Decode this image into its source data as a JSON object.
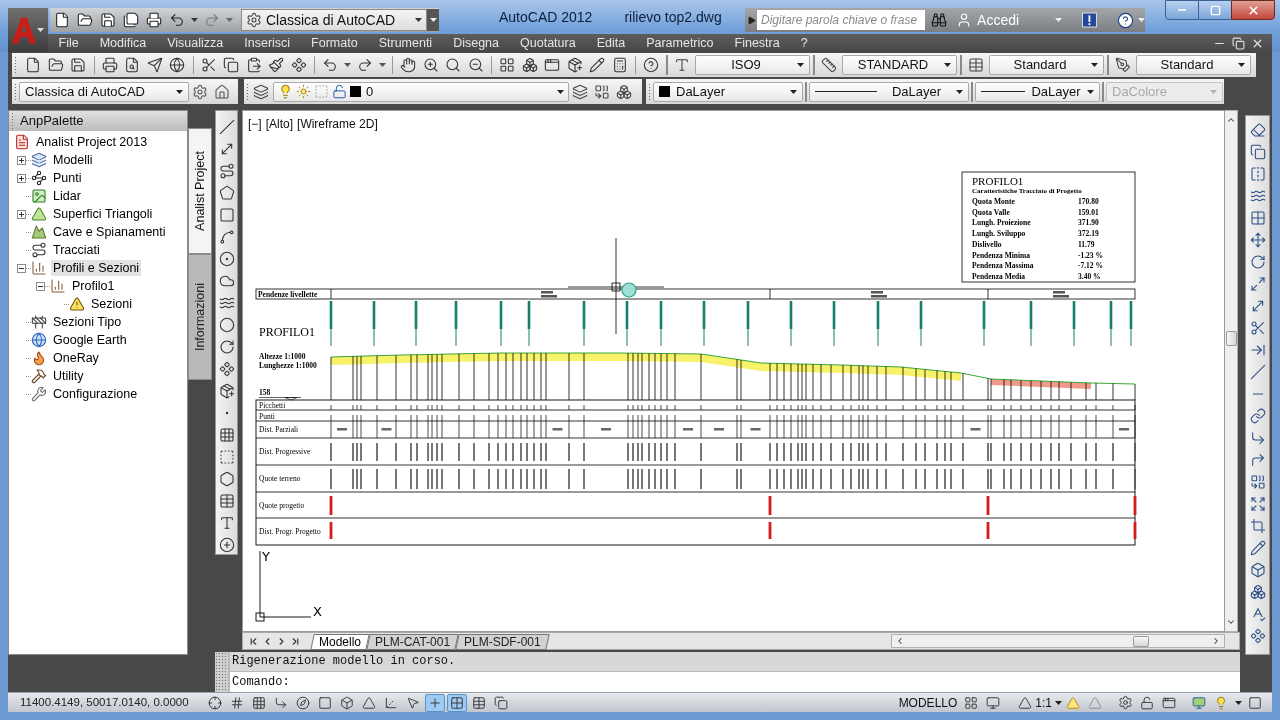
{
  "title": {
    "app": "AutoCAD 2012",
    "file": "rilievo top2.dwg"
  },
  "quick_access": {
    "workspace": "Classica di AutoCAD"
  },
  "infocenter": {
    "placeholder": "Digitare parola chiave o frase",
    "sign_in": "Accedi"
  },
  "menu": [
    "File",
    "Modifica",
    "Visualizza",
    "Inserisci",
    "Formato",
    "Strumenti",
    "Disegna",
    "Quotatura",
    "Edita",
    "Parametrico",
    "Finestra",
    "?"
  ],
  "style_toolbar": [
    {
      "kind": "text",
      "value": "ISO9"
    },
    {
      "kind": "dimension",
      "value": "STANDARD"
    },
    {
      "kind": "table",
      "value": "Standard"
    },
    {
      "kind": "multileader",
      "value": "Standard"
    }
  ],
  "workspace_toolbar": {
    "workspace": "Classica di AutoCAD"
  },
  "layer_toolbar": {
    "layer": "0"
  },
  "properties_toolbar": [
    {
      "kind": "color",
      "value": "DaLayer",
      "disabled": false
    },
    {
      "kind": "linetype",
      "value": "DaLayer",
      "disabled": false
    },
    {
      "kind": "lineweight",
      "value": "DaLayer",
      "disabled": false
    },
    {
      "kind": "plot_style",
      "value": "DaColore",
      "disabled": true
    }
  ],
  "palette": {
    "title": "AnpPalette",
    "tree": {
      "label": "Analist Project 2013",
      "kind": "project",
      "selected": false,
      "children": [
        {
          "label": "Modelli",
          "kind": "layers",
          "expanded": false,
          "selected": false
        },
        {
          "label": "Punti",
          "kind": "points",
          "expanded": false,
          "selected": false
        },
        {
          "label": "Lidar",
          "kind": "image",
          "selected": false
        },
        {
          "label": "Superfici Triangoli",
          "kind": "surface",
          "expanded": false,
          "selected": false
        },
        {
          "label": "Cave e Spianamenti",
          "kind": "quarry",
          "selected": false
        },
        {
          "label": "Tracciati",
          "kind": "alignment",
          "selected": false
        },
        {
          "label": "Profili e Sezioni",
          "kind": "profile",
          "expanded": true,
          "selected": true,
          "children": [
            {
              "label": "Profilo1",
              "kind": "profile",
              "expanded": true,
              "selected": false,
              "children": [
                {
                  "label": "Sezioni",
                  "kind": "warning",
                  "selected": false
                }
              ]
            }
          ]
        },
        {
          "label": "Sezioni Tipo",
          "kind": "section",
          "selected": false
        },
        {
          "label": "Google Earth",
          "kind": "globe",
          "selected": false
        },
        {
          "label": "OneRay",
          "kind": "ray",
          "selected": false
        },
        {
          "label": "Utility",
          "kind": "tools",
          "selected": false
        },
        {
          "label": "Configurazione",
          "kind": "config",
          "selected": false
        }
      ]
    },
    "tabs": [
      {
        "label": "Analist Project",
        "selected": true
      },
      {
        "label": "Informazioni",
        "selected": false
      }
    ]
  },
  "viewport": {
    "controls": [
      "[−]",
      "[Alto]",
      "[Wireframe 2D]"
    ]
  },
  "drawing": {
    "info_box": {
      "title": "PROFILO1",
      "subtitle": "Caratteristiche Tracciato di Progetto",
      "rows": [
        {
          "label": "Quota Monte",
          "value": "170.80"
        },
        {
          "label": "Quota Valle",
          "value": "159.01"
        },
        {
          "label": "Lungh. Proiezione",
          "value": "371.90"
        },
        {
          "label": "Lungh. Sviluppo",
          "value": "372.19"
        },
        {
          "label": "Dislivello",
          "value": "11.79"
        },
        {
          "label": "Pendenza Minima",
          "value": "-1.23 %"
        },
        {
          "label": "Pendenza Massima",
          "value": "-7.12 %"
        },
        {
          "label": "Pendenza Media",
          "value": "3.40 %"
        }
      ]
    },
    "band_label": "Pendenze livellette",
    "profile_title": "PROFILO1",
    "scales": [
      "Altezze 1:1000",
      "Lunghezze 1:1000"
    ],
    "datum": "158",
    "table_rows": [
      "Picchetti",
      "Punti",
      "Dist. Parziali",
      "Dist. Progressive",
      "Quote terreno",
      "Quote progetto",
      "Dist. Progr. Progetto"
    ],
    "axis_labels": {
      "y": "Y",
      "x": "X"
    }
  },
  "layout_tabs": [
    {
      "label": "Modello",
      "selected": true
    },
    {
      "label": "PLM-CAT-001",
      "selected": false
    },
    {
      "label": "PLM-SDF-001",
      "selected": false
    }
  ],
  "command": {
    "history": "Rigenerazione modello in corso.",
    "prompt": "Comando:"
  },
  "status_bar": {
    "coordinates": "11400.4149, 50017.0140, 0.0000",
    "toggles": [
      {
        "kind": "constraints",
        "on": false
      },
      {
        "kind": "snap",
        "on": false
      },
      {
        "kind": "grid",
        "on": false
      },
      {
        "kind": "ortho",
        "on": false
      },
      {
        "kind": "polar",
        "on": false
      },
      {
        "kind": "osnap",
        "on": false
      },
      {
        "kind": "osnap3d",
        "on": false
      },
      {
        "kind": "otrack",
        "on": false
      },
      {
        "kind": "ducs",
        "on": false
      },
      {
        "kind": "dynamic",
        "on": false
      },
      {
        "kind": "lineweight",
        "on": true
      },
      {
        "kind": "transparency",
        "on": true
      },
      {
        "kind": "quick_properties",
        "on": false
      },
      {
        "kind": "selection_cycling",
        "on": false
      }
    ],
    "space": "MODELLO",
    "annotation_scale": "1:1"
  }
}
